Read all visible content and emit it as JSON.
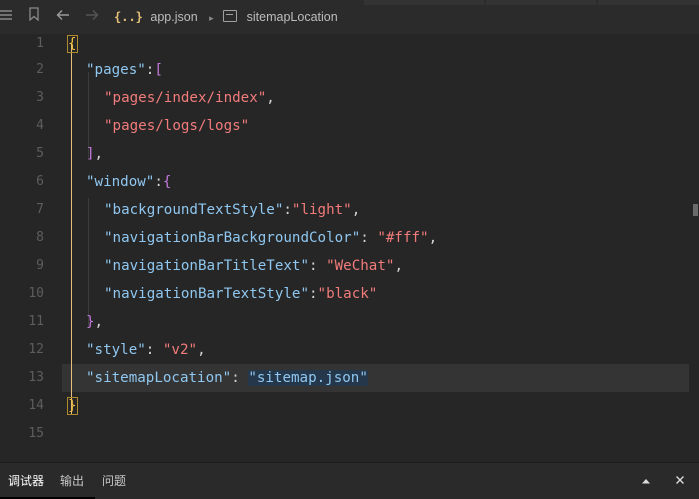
{
  "toolbar": {
    "menu_icon": "hamburger-icon",
    "bookmark_icon": "bookmark-icon",
    "back_icon": "arrow-left-icon",
    "forward_icon": "arrow-right-icon",
    "file_badge": "{..}",
    "file_name": "app.json",
    "breadcrumb_sep": "▸",
    "symbol_name": "sitemapLocation"
  },
  "editor": {
    "line_numbers": [
      "1",
      "2",
      "3",
      "4",
      "5",
      "6",
      "7",
      "8",
      "9",
      "10",
      "11",
      "12",
      "13",
      "14",
      "15"
    ],
    "current_line": 13
  },
  "panel": {
    "tabs": [
      "调试器",
      "输出",
      "问题"
    ],
    "active_tab": "调试器",
    "collapse_icon": "chevron-up-icon",
    "close_icon": "close-icon"
  },
  "colors": {
    "background": "#262626",
    "brace": "#f0c040",
    "bracket": "#c678dd",
    "key": "#8fc7f0",
    "string": "#f27b7b"
  }
}
